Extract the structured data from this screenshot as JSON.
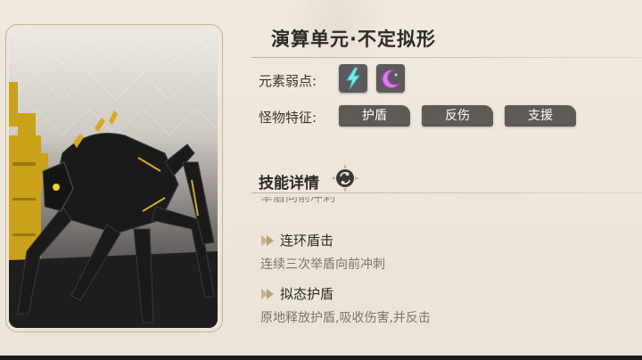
{
  "monster": {
    "name": "演算单元·不定拟形"
  },
  "weakness": {
    "label": "元素弱点:",
    "icons": [
      "lightning-element-icon",
      "crescent-element-icon"
    ]
  },
  "traits": {
    "label": "怪物特征:",
    "tags": [
      "护盾",
      "反伤",
      "支援"
    ]
  },
  "skills": {
    "heading": "技能详情",
    "clipped_prev_text": "举盾向前冲刺",
    "items": [
      {
        "name": "连环盾击",
        "desc": "连续三次举盾向前冲刺"
      },
      {
        "name": "拟态护盾",
        "desc": "原地释放护盾,吸收伤害,并反击"
      }
    ]
  }
}
